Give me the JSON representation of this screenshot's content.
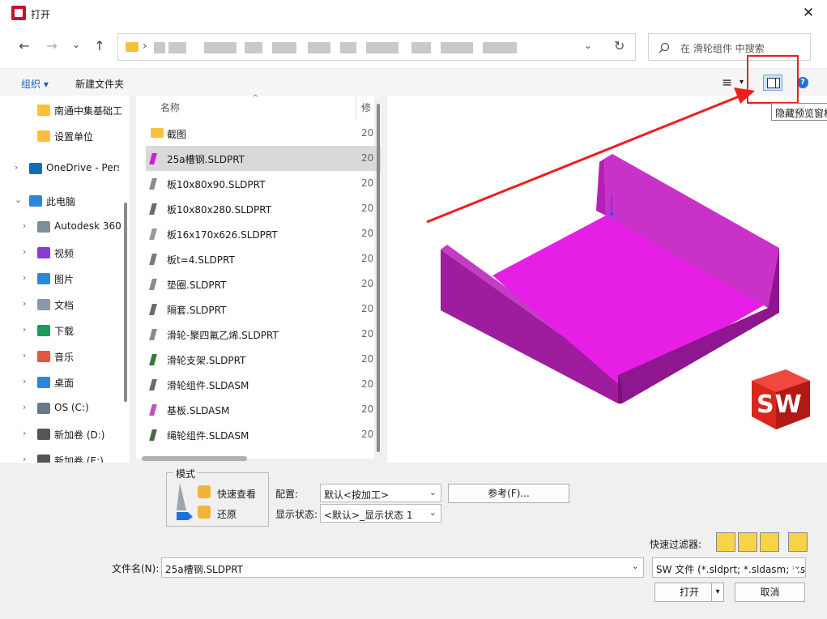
{
  "window": {
    "title": "打开",
    "close_glyph": "✕"
  },
  "nav": {
    "back": "←",
    "forward": "→",
    "recent": "⌄",
    "up": "↑",
    "chevron": "›",
    "dropdown": "⌄",
    "refresh": "↻"
  },
  "search": {
    "placeholder": "在 滑轮组件 中搜索",
    "icon": "search-icon"
  },
  "toolbar": {
    "organize_label": "组织 ▾",
    "new_folder_label": "新建文件夹",
    "view_glyph": "≡",
    "help_glyph": "?"
  },
  "sidebar": {
    "items": [
      {
        "label": "南通中集基础工",
        "icon": "folder-icon",
        "color": "#f7c23a",
        "arrow": ""
      },
      {
        "label": "设置单位",
        "icon": "folder-icon",
        "color": "#f7c23a",
        "arrow": ""
      },
      {
        "label": "OneDrive - Pers",
        "icon": "cloud-icon",
        "color": "#0f6cbd",
        "arrow": "›"
      },
      {
        "label": "此电脑",
        "icon": "computer-icon",
        "color": "#2b88d8",
        "arrow": "⌄"
      },
      {
        "label": "Autodesk 360",
        "icon": "autodesk-icon",
        "color": "#7d8e9b",
        "arrow": "›"
      },
      {
        "label": "视频",
        "icon": "video-icon",
        "color": "#8a3bd4",
        "arrow": "›"
      },
      {
        "label": "图片",
        "icon": "picture-icon",
        "color": "#2b88d8",
        "arrow": "›"
      },
      {
        "label": "文档",
        "icon": "document-icon",
        "color": "#8a99a8",
        "arrow": "›"
      },
      {
        "label": "下载",
        "icon": "download-icon",
        "color": "#1a9a5b",
        "arrow": "›"
      },
      {
        "label": "音乐",
        "icon": "music-icon",
        "color": "#e4563a",
        "arrow": "›"
      },
      {
        "label": "桌面",
        "icon": "desktop-icon",
        "color": "#2b88d8",
        "arrow": "›"
      },
      {
        "label": "OS (C:)",
        "icon": "drive-icon",
        "color": "#6b7a89",
        "arrow": "›"
      },
      {
        "label": "新加卷 (D:)",
        "icon": "drive-icon",
        "color": "#555555",
        "arrow": "›"
      },
      {
        "label": "新加卷 (E:)",
        "icon": "drive-icon",
        "color": "#555555",
        "arrow": "›"
      }
    ]
  },
  "filelist": {
    "header_name": "名称",
    "header_date": "修",
    "sort_glyph": "^",
    "rows": [
      {
        "name": "截图",
        "date": "20",
        "icon": "folder-icon",
        "color": "#f7c23a",
        "selected": false
      },
      {
        "name": "25a槽钢.SLDPRT",
        "date": "20",
        "icon": "sldprt-icon",
        "color": "#d41cd4",
        "selected": true
      },
      {
        "name": "板10x80x90.SLDPRT",
        "date": "20",
        "icon": "sldprt-icon",
        "color": "#8a8a8a",
        "selected": false
      },
      {
        "name": "板10x80x280.SLDPRT",
        "date": "20",
        "icon": "sldprt-icon",
        "color": "#6b6b6b",
        "selected": false
      },
      {
        "name": "板16x170x626.SLDPRT",
        "date": "20",
        "icon": "sldprt-icon",
        "color": "#9a9a9a",
        "selected": false
      },
      {
        "name": "板t=4.SLDPRT",
        "date": "20",
        "icon": "sldprt-icon",
        "color": "#7a7a7a",
        "selected": false
      },
      {
        "name": "垫圈.SLDPRT",
        "date": "20",
        "icon": "sldprt-icon",
        "color": "#8a8a8a",
        "selected": false
      },
      {
        "name": "隔套.SLDPRT",
        "date": "20",
        "icon": "sldprt-icon",
        "color": "#6a6a6a",
        "selected": false
      },
      {
        "name": "滑轮-聚四氟乙烯.SLDPRT",
        "date": "20",
        "icon": "sldprt-icon",
        "color": "#8a8a8a",
        "selected": false
      },
      {
        "name": "滑轮支架.SLDPRT",
        "date": "20",
        "icon": "sldprt-icon",
        "color": "#2e7d32",
        "selected": false
      },
      {
        "name": "滑轮组件.SLDASM",
        "date": "20",
        "icon": "sldasm-icon",
        "color": "#6a6a6a",
        "selected": false
      },
      {
        "name": "基板.SLDASM",
        "date": "20",
        "icon": "sldasm-icon",
        "color": "#c050c0",
        "selected": false
      },
      {
        "name": "绳轮组件.SLDASM",
        "date": "20",
        "icon": "sldasm-icon",
        "color": "#4a6a4a",
        "selected": false
      }
    ]
  },
  "preview": {
    "tooltip": "隐藏预览窗格",
    "logo_text": "SW",
    "accent": "#ee1e1e",
    "part_color": "#e21ce2"
  },
  "mode": {
    "legend": "模式",
    "quick_view_label": "快速查看",
    "restore_label": "还原"
  },
  "config": {
    "config_label": "配置:",
    "config_value": "默认<按加工>",
    "display_label": "显示状态:",
    "display_value": "<默认>_显示状态 1",
    "reference_label": "参考(F)..."
  },
  "filter": {
    "label": "快速过滤器:"
  },
  "filename": {
    "label": "文件名(N):",
    "value": "25a槽钢.SLDPRT"
  },
  "filetype": {
    "value": "SW 文件 (*.sldprt; *.sldasm; *.slddrw; *.sld"
  },
  "actions": {
    "open_label": "打开",
    "cancel_label": "取消",
    "split_glyph": "▾"
  }
}
